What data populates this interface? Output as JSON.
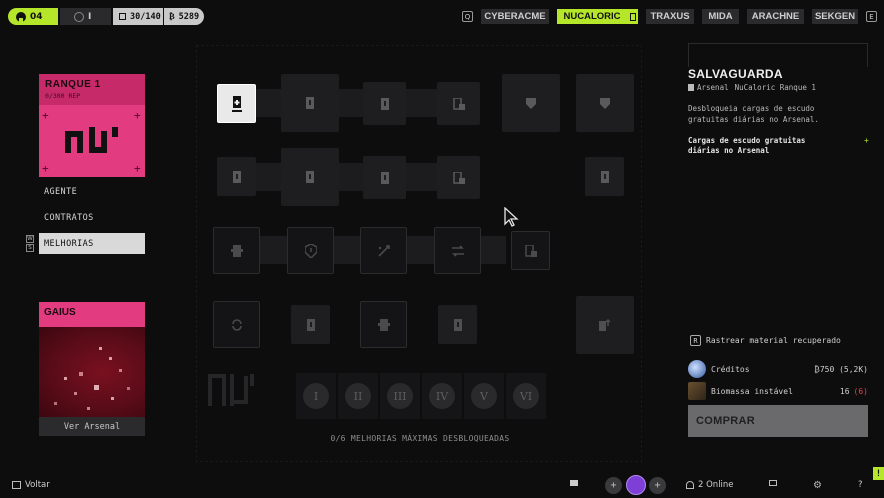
{
  "topbar": {
    "level": "04",
    "rank_value": "I",
    "inventory": "30/140",
    "currency": "5289",
    "left_key": "Q",
    "right_key": "E",
    "factions": [
      {
        "label": "CYBERACME",
        "active": false
      },
      {
        "label": "NUCALORIC",
        "active": true
      },
      {
        "label": "TRAXUS",
        "active": false
      },
      {
        "label": "MIDA",
        "active": false
      },
      {
        "label": "ARACHNE",
        "active": false
      },
      {
        "label": "SEKGEN",
        "active": false
      }
    ]
  },
  "rank_card": {
    "title": "RANQUE 1",
    "rep": "0/300 REP"
  },
  "menu": {
    "items": [
      "AGENTE",
      "CONTRATOS",
      "MELHORIAS"
    ],
    "active_index": 2,
    "key_up": "W",
    "key_down": "S"
  },
  "gaius_card": {
    "name": "GAIUS",
    "button": "Ver Arsenal"
  },
  "grid": {
    "tiers": [
      "I",
      "II",
      "III",
      "IV",
      "V",
      "VI"
    ],
    "status": "0/6 MELHORIAS MÁXIMAS DESBLOQUEADAS"
  },
  "detail": {
    "title": "SALVAGUARDA",
    "source": "Arsenal",
    "requirement": "NuCaloric Ranque 1",
    "description": "Desbloqueia cargas de escudo gratuitas diárias no Arsenal.",
    "bonus": "Cargas de escudo gratuitas diárias no Arsenal",
    "bonus_marker": "+"
  },
  "costs": {
    "track_key": "R",
    "track_label": "Rastrear material recuperado",
    "items": [
      {
        "name": "Créditos",
        "value": "₿750 (5,2K)",
        "missing": ""
      },
      {
        "name": "Biomassa instável",
        "value": "16",
        "missing": "(6)"
      }
    ],
    "buy_label": "COMPRAR"
  },
  "bottombar": {
    "back_label": "Voltar",
    "online": "2 Online",
    "help": "?",
    "flag": "!"
  },
  "colors": {
    "accent_green": "#b6e62a",
    "faction_pink": "#e23b7f",
    "missing_red": "#e0464c"
  }
}
